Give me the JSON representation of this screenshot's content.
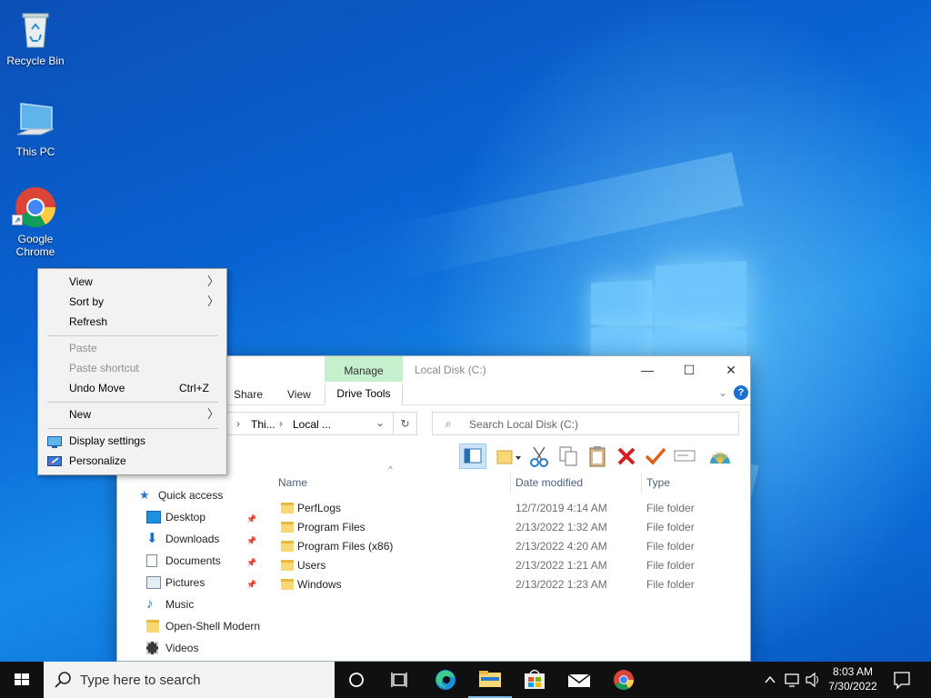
{
  "desktop": {
    "icons": [
      {
        "label": "Recycle Bin"
      },
      {
        "label": "This PC"
      },
      {
        "label": "Google Chrome"
      }
    ]
  },
  "context_menu": {
    "items": {
      "view": "View",
      "sort_by": "Sort by",
      "refresh": "Refresh",
      "paste": "Paste",
      "paste_shortcut": "Paste shortcut",
      "undo_move": "Undo Move",
      "undo_shortcut": "Ctrl+Z",
      "new": "New",
      "display_settings": "Display settings",
      "personalize": "Personalize"
    }
  },
  "explorer": {
    "title": "Local Disk (C:)",
    "manage_tab": "Manage",
    "ribbon_tabs": {
      "share": "Share",
      "view": "View",
      "drive_tools": "Drive Tools"
    },
    "breadcrumb": [
      "Thi...",
      "Local ..."
    ],
    "search_placeholder": "Search Local Disk (C:)",
    "nav": {
      "quick_access": "Quick access",
      "items": [
        {
          "label": "Desktop",
          "pinned": true
        },
        {
          "label": "Downloads",
          "pinned": true
        },
        {
          "label": "Documents",
          "pinned": true
        },
        {
          "label": "Pictures",
          "pinned": true
        },
        {
          "label": "Music",
          "pinned": false
        },
        {
          "label": "Open-Shell Modern",
          "pinned": false
        },
        {
          "label": "Videos",
          "pinned": false
        }
      ]
    },
    "columns": {
      "name": "Name",
      "date": "Date modified",
      "type": "Type"
    },
    "files": [
      {
        "name": "PerfLogs",
        "date": "12/7/2019 4:14 AM",
        "type": "File folder"
      },
      {
        "name": "Program Files",
        "date": "2/13/2022 1:32 AM",
        "type": "File folder"
      },
      {
        "name": "Program Files (x86)",
        "date": "2/13/2022 4:20 AM",
        "type": "File folder"
      },
      {
        "name": "Users",
        "date": "2/13/2022 1:21 AM",
        "type": "File folder"
      },
      {
        "name": "Windows",
        "date": "2/13/2022 1:23 AM",
        "type": "File folder"
      }
    ]
  },
  "taskbar": {
    "search_placeholder": "Type here to search",
    "pinned": [
      "cortana-icon",
      "task-view-icon",
      "edge-icon",
      "file-explorer-icon",
      "store-icon",
      "mail-icon",
      "chrome-icon"
    ],
    "clock": {
      "time": "8:03 AM",
      "date": "7/30/2022"
    }
  },
  "colors": {
    "accent": "#0078d7",
    "manage_tab": "#c6efce",
    "taskbar": "#101010"
  }
}
